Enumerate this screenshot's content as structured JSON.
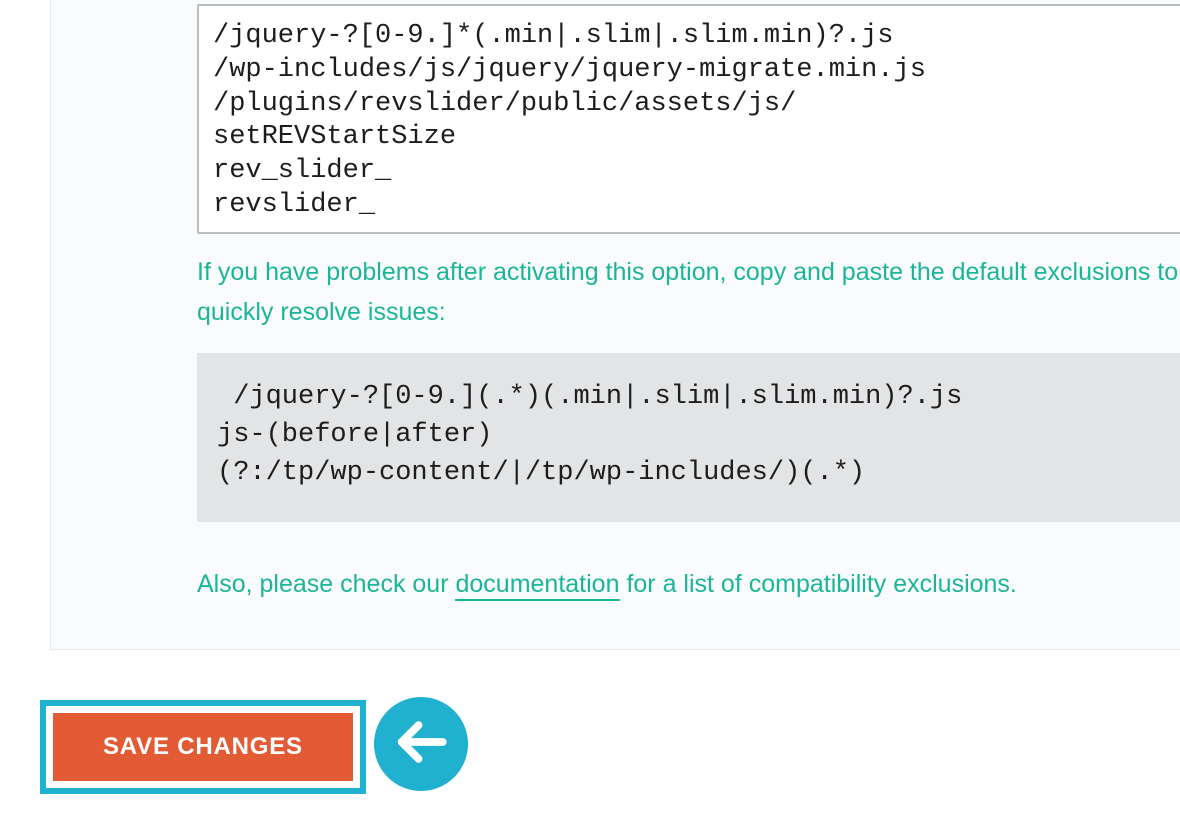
{
  "textarea": {
    "value": "/jquery-?[0-9.]*(.min|.slim|.slim.min)?.js\n/wp-includes/js/jquery/jquery-migrate.min.js\n/plugins/revslider/public/assets/js/\nsetREVStartSize\nrev_slider_\nrevslider_"
  },
  "helper": {
    "text": "If you have problems after activating this option, copy and paste the default exclusions to quickly resolve issues:"
  },
  "default_exclusions": {
    "code": " /jquery-?[0-9.](.*)(.min|.slim|.slim.min)?.js\njs-(before|after)\n(?:/tp/wp-content/|/tp/wp-includes/)(.*)"
  },
  "doc_line": {
    "prefix": "Also, please check our ",
    "link": "documentation",
    "suffix": " for a list of compatibility exclusions."
  },
  "buttons": {
    "save": "SAVE CHANGES"
  },
  "colors": {
    "accent_teal": "#1bb598",
    "highlight_blue": "#1fb1ce",
    "button_orange": "#e25b34",
    "panel_bg": "#fafbfc",
    "code_bg": "#e3e4e5"
  }
}
